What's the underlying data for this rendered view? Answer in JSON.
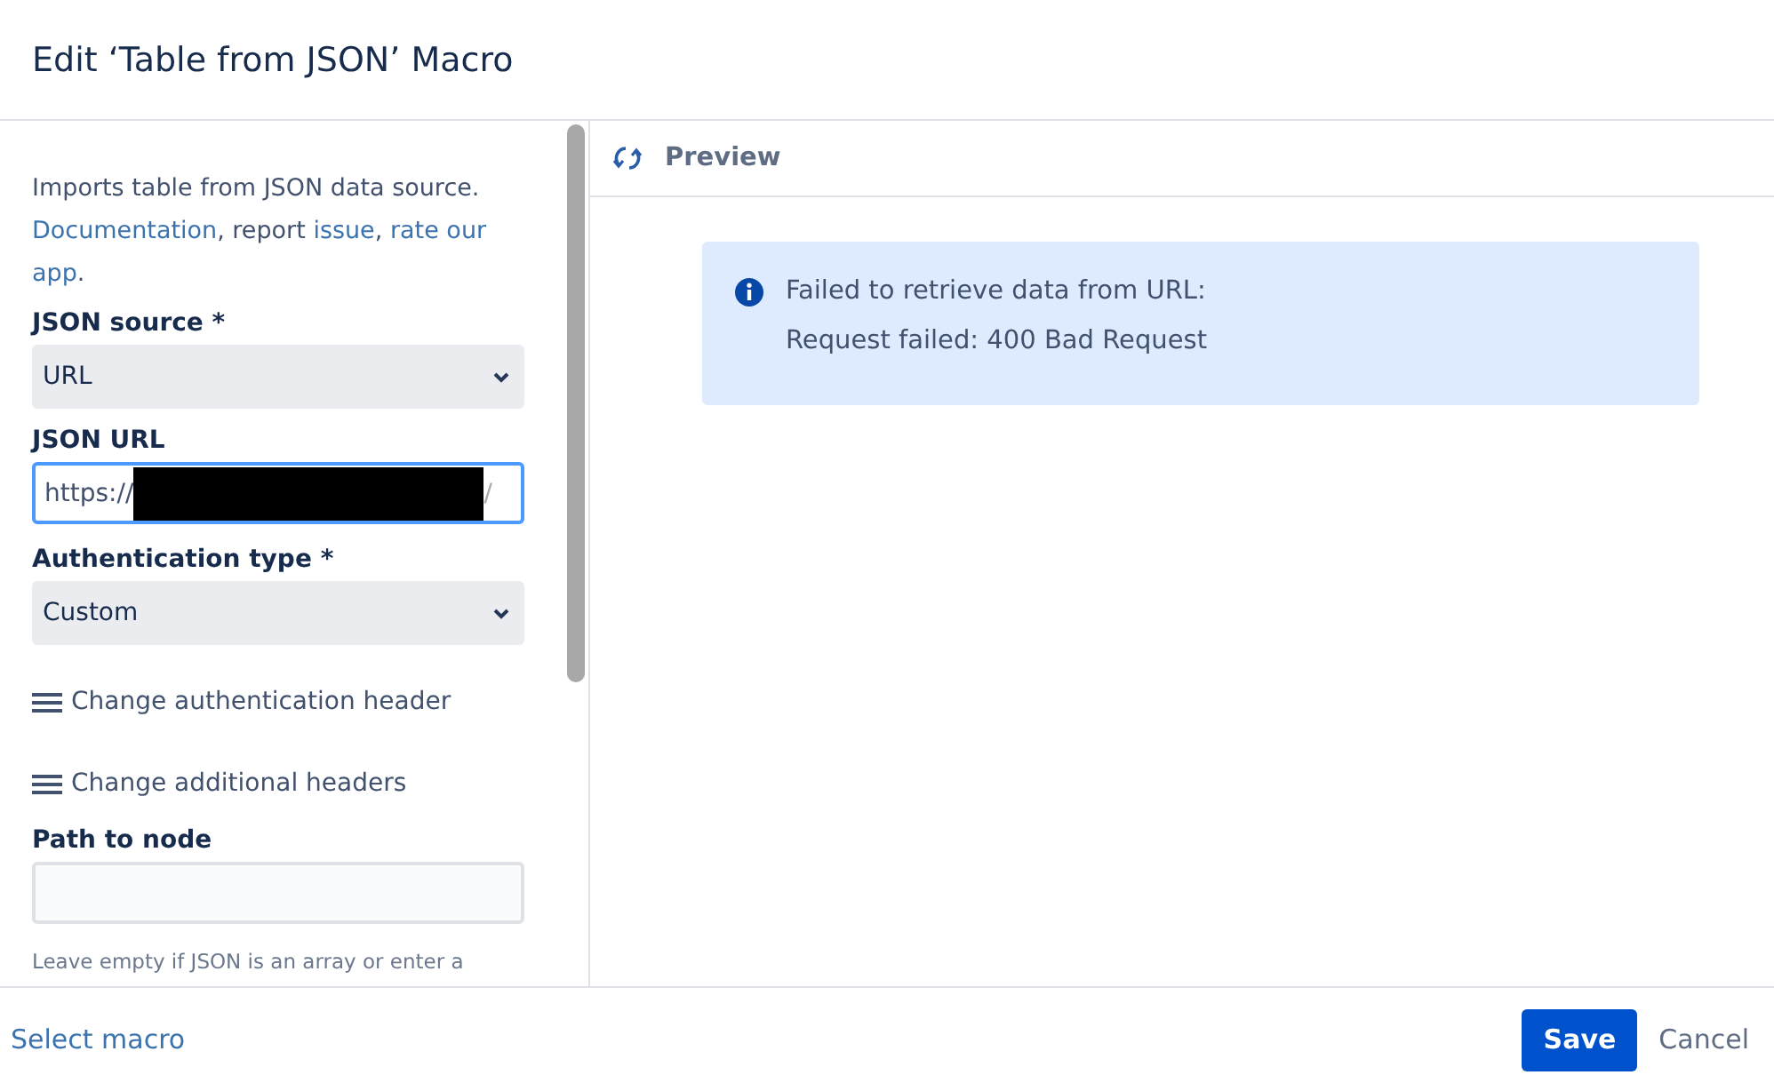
{
  "dialog": {
    "title": "Edit ‘Table from JSON’ Macro"
  },
  "sidebar": {
    "description": {
      "text": "Imports table from JSON data source.",
      "segments": [
        {
          "text": "Documentation",
          "link": true
        },
        {
          "text": ", report ",
          "link": false
        },
        {
          "text": "issue",
          "link": true
        },
        {
          "text": ", ",
          "link": false
        },
        {
          "text": "rate our",
          "link": true
        },
        {
          "text": "app",
          "link": true
        },
        {
          "text": ".",
          "link": false
        }
      ]
    },
    "fields": [
      {
        "kind": "select",
        "label": "JSON source *",
        "value": "URL"
      },
      {
        "kind": "url",
        "label": "JSON URL",
        "value_start": "https://",
        "value_end": "/",
        "redacted": true,
        "focused": true
      },
      {
        "kind": "select",
        "label": "Authentication type *",
        "value": "Custom"
      },
      {
        "kind": "toggle",
        "label": "Change authentication header"
      },
      {
        "kind": "toggle",
        "label": "Change additional headers"
      },
      {
        "kind": "text",
        "label": "Path to node"
      }
    ],
    "hint": "Leave empty if JSON is an array or enter a"
  },
  "preview": {
    "title": "Preview",
    "message": {
      "lines": [
        "Failed to retrieve data from URL:",
        "Request failed: 400 Bad Request"
      ]
    }
  },
  "footer": {
    "link": "Select macro",
    "buttons": [
      {
        "label": "Save",
        "kind": "primary"
      },
      {
        "label": "Cancel",
        "kind": "link"
      }
    ]
  }
}
